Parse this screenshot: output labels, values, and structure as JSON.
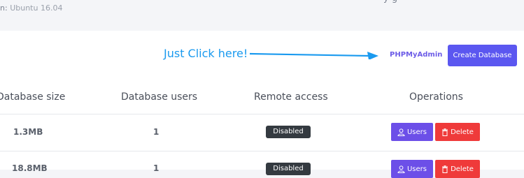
{
  "os": {
    "label": "n:",
    "value": "Ubuntu 16.04"
  },
  "top_clip": "y    g",
  "annotation": {
    "text": "Just Click here!",
    "color": "#1a9aef"
  },
  "toolbar": {
    "phpmyadmin_label": "PHPMyAdmin",
    "create_label": "Create Database"
  },
  "table": {
    "headers": [
      "Database size",
      "Database users",
      "Remote access",
      "Operations"
    ],
    "rows": [
      {
        "size": "1.3MB",
        "users": "1",
        "remote": "Disabled",
        "users_btn": "Users",
        "delete_btn": "Delete"
      },
      {
        "size": "18.8MB",
        "users": "1",
        "remote": "Disabled",
        "users_btn": "Users",
        "delete_btn": "Delete"
      }
    ]
  },
  "colors": {
    "accent": "#5b57f0",
    "users_button": "#6c4fe8",
    "delete_button": "#ef3a3a",
    "badge": "#343a40",
    "link": "#6c5ce7"
  },
  "icons": {
    "users_button": "user-icon",
    "delete_button": "trash-icon",
    "annotation": "arrow-right-icon"
  }
}
